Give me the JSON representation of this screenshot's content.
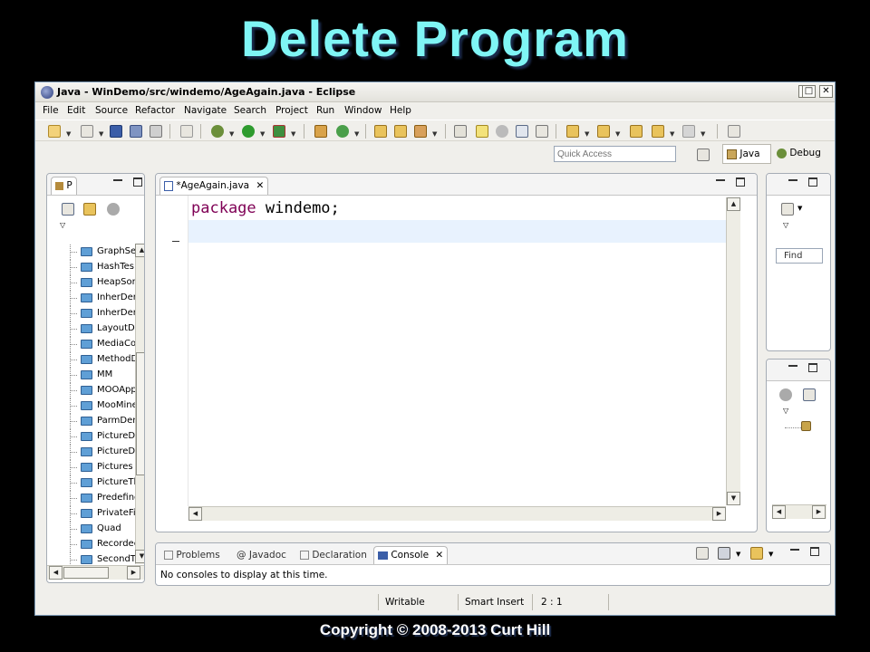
{
  "slide": {
    "title": "Delete Program",
    "copyright": "Copyright © 2008-2013 Curt Hill"
  },
  "window": {
    "title": "Java - WinDemo/src/windemo/AgeAgain.java - Eclipse",
    "minimize": "_",
    "restore": "□",
    "close": "✕"
  },
  "menu": [
    "File",
    "Edit",
    "Source",
    "Refactor",
    "Navigate",
    "Search",
    "Project",
    "Run",
    "Window",
    "Help"
  ],
  "quick_access": {
    "placeholder": "Quick Access"
  },
  "perspectives": {
    "java": "Java",
    "debug": "Debug"
  },
  "explorer": {
    "tab_label": "P",
    "items": [
      "GraphSe",
      "HashTes",
      "HeapSor",
      "InherDer",
      "InherDer",
      "LayoutDe",
      "MediaCo",
      "MethodD",
      "MM",
      "MOOApp",
      "MooMine",
      "ParmDen",
      "PictureDe",
      "PictureDe",
      "Pictures",
      "PictureTh",
      "Predefine",
      "PrivateFi",
      "Quad",
      "Recordec",
      "SecondT"
    ]
  },
  "editor": {
    "tab_label": "*AgeAgain.java",
    "code": {
      "keyword": "package",
      "rest": " windemo;"
    }
  },
  "outline": {
    "find_label": "Find"
  },
  "console": {
    "tabs": [
      "Problems",
      "Javadoc",
      "Declaration",
      "Console"
    ],
    "message": "No consoles to display at this time."
  },
  "status": {
    "mode": "Writable",
    "insert": "Smart Insert",
    "position": "2 : 1"
  }
}
